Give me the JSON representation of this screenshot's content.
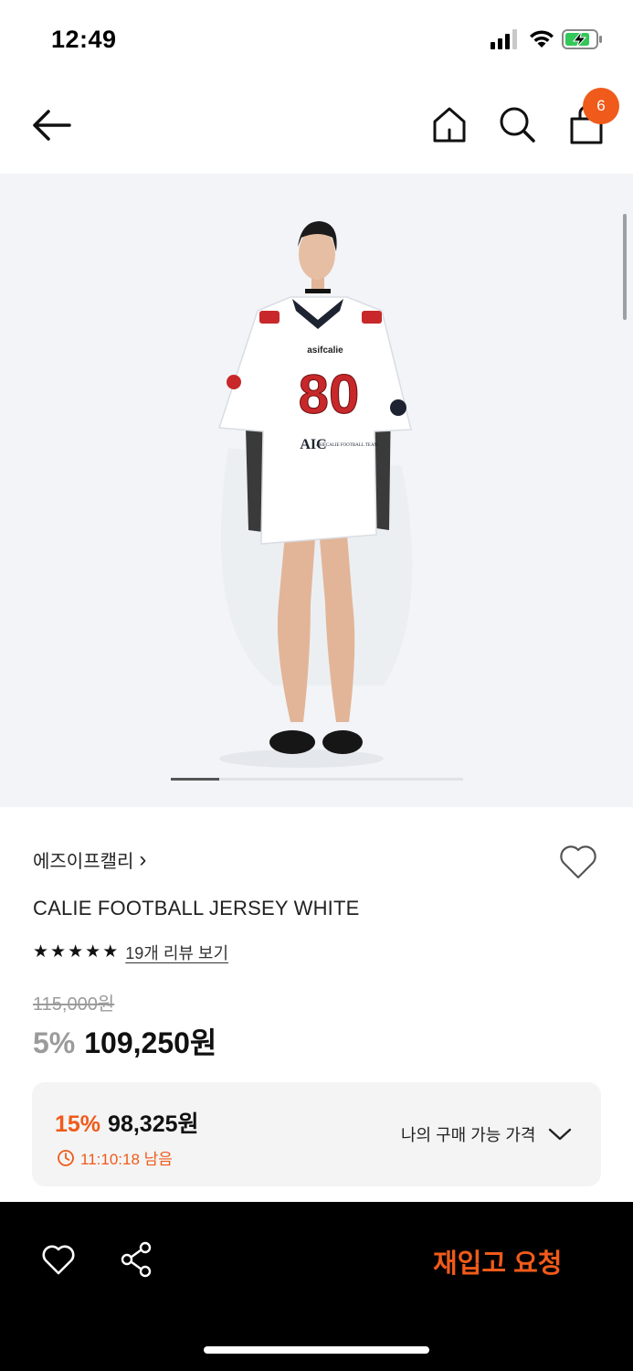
{
  "status_bar": {
    "time": "12:49"
  },
  "nav": {
    "cart_count": "6"
  },
  "brand": {
    "name": "에즈이프캘리",
    "chevron": "›"
  },
  "product": {
    "name": "CALIE FOOTBALL JERSEY WHITE",
    "rating_stars": 5,
    "review_link": "19개 리뷰 보기",
    "original_price": "115,000원",
    "discount": "5%",
    "price": "109,250원"
  },
  "hero_image": {
    "jersey_brand": "asifcalie",
    "jersey_number": "80",
    "jersey_crest": "AIC",
    "jersey_sub": "ASIFCALIE FOOTBALL TEAM"
  },
  "coupon": {
    "discount": "15%",
    "price": "98,325원",
    "timer": "11:10:18 남음",
    "my_price_label": "나의 구매 가능 가격"
  },
  "bottom_bar": {
    "restock_label": "재입고 요청"
  },
  "icons": [
    "back-arrow-icon",
    "home-icon",
    "search-icon",
    "shopping-bag-icon",
    "heart-icon",
    "share-icon",
    "clock-icon",
    "chevron-down-icon"
  ],
  "colors": {
    "accent": "#f05a1a",
    "coupon_bg": "#f4f4f4",
    "bottom_bar": "#000000"
  }
}
